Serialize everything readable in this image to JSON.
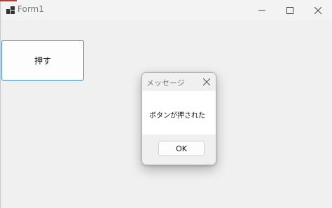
{
  "window": {
    "title": "Form1",
    "app_icon": "windows-form-icon",
    "controls": {
      "minimize_icon": "minimize-icon",
      "maximize_icon": "maximize-icon",
      "close_icon": "close-icon"
    },
    "accent_color": "#c0392b"
  },
  "form": {
    "push_button_label": "押す",
    "push_button_border_color": "#3a8dd6"
  },
  "dialog": {
    "title": "メッセージ",
    "close_icon": "close-icon",
    "message": "ボタンが押された",
    "ok_label": "OK"
  }
}
